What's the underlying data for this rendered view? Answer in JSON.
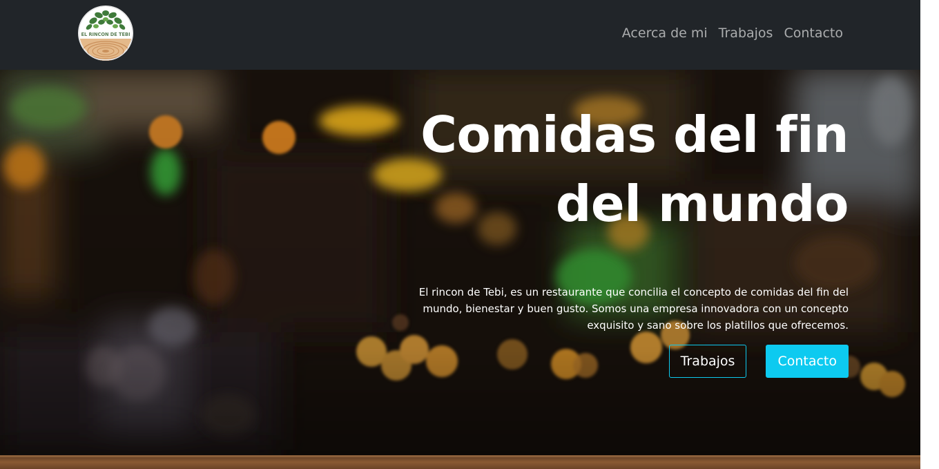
{
  "navbar": {
    "logo_text": "EL RINCON DE TEBI",
    "links": [
      "Acerca de mi",
      "Trabajos",
      "Contacto"
    ]
  },
  "hero": {
    "title_line1": "Comidas del fin",
    "title_line2": "del mundo",
    "description": "El rincon de Tebi, es un restaurante que concilia el concepto de comidas del fin del mundo, bienestar y buen gusto. Somos una empresa innovadora con un concepto exquisito y sano sobre los platillos que ofrecemos.",
    "buttons": {
      "works_label": "Trabajos",
      "contact_label": "Contacto"
    }
  },
  "colors": {
    "navbar_bg": "#212529",
    "accent": "#0dcaf0",
    "nav_link": "rgba(255,255,255,0.62)"
  }
}
